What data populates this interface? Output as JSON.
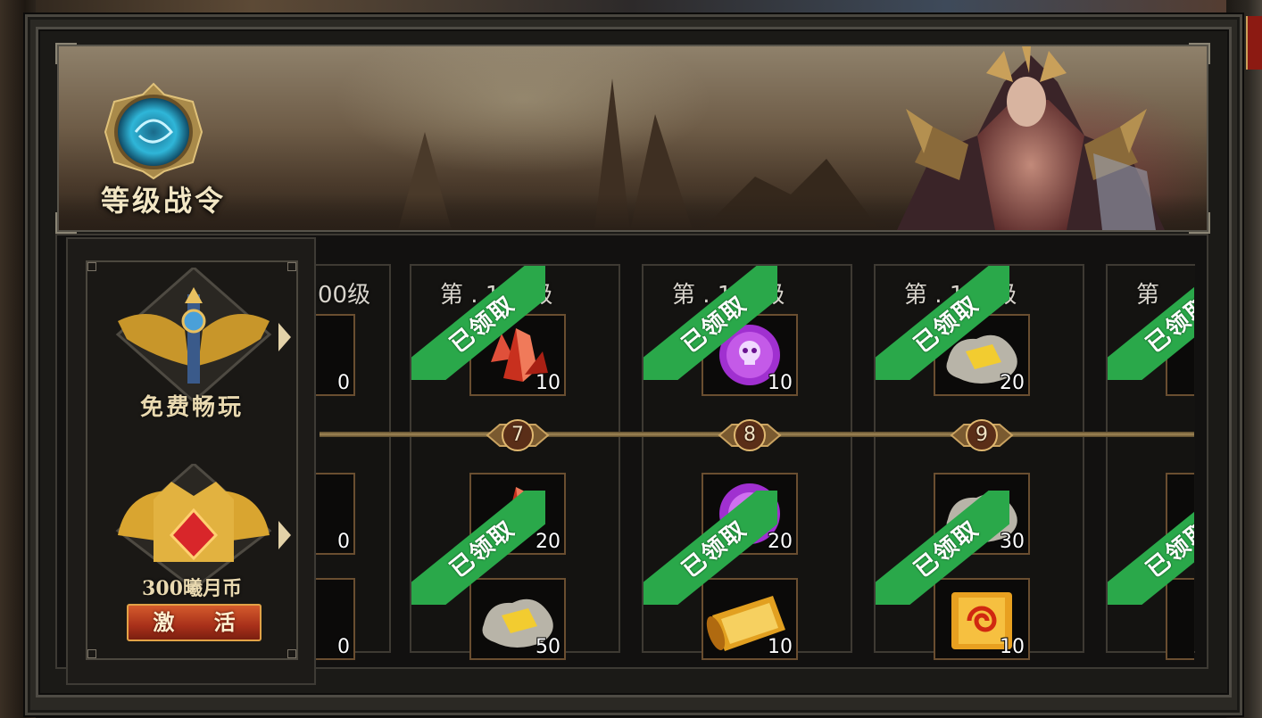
{
  "window": {
    "title": "等级战令"
  },
  "tiers": {
    "free_label": "免费畅玩",
    "paid_price": "300曦月币",
    "activate_label": "激 活"
  },
  "columns": [
    {
      "level_label": "00级",
      "free_qty": "0",
      "paid1_qty": "0",
      "paid2_qty": "0"
    },
    {
      "level_label": "第  . 110级",
      "node": "7",
      "status": "已领取",
      "free_qty": "10",
      "paid1_qty": "20",
      "paid2_qty": "50",
      "free_item": "red-crystal-icon",
      "paid1_item": "red-crystal-icon",
      "paid2_item": "gold-ore-icon"
    },
    {
      "level_label": "第  . 130级",
      "node": "8",
      "status": "已领取",
      "free_qty": "10",
      "paid1_qty": "20",
      "paid2_qty": "10",
      "free_item": "purple-skull-orb-icon",
      "paid1_item": "purple-orb-icon",
      "paid2_item": "golden-scroll-icon"
    },
    {
      "level_label": "第  . 150级",
      "node": "9",
      "status": "已领取",
      "free_qty": "20",
      "paid1_qty": "30",
      "paid2_qty": "10",
      "free_item": "gold-ore-icon",
      "paid1_item": "gold-ore-icon",
      "paid2_item": "spiral-scroll-icon"
    },
    {
      "level_label": "第",
      "status": "已领取"
    }
  ],
  "colors": {
    "ribbon_green": "#2aa84a",
    "frame_brown": "#6a4e30",
    "button_red": "#a8301a"
  }
}
